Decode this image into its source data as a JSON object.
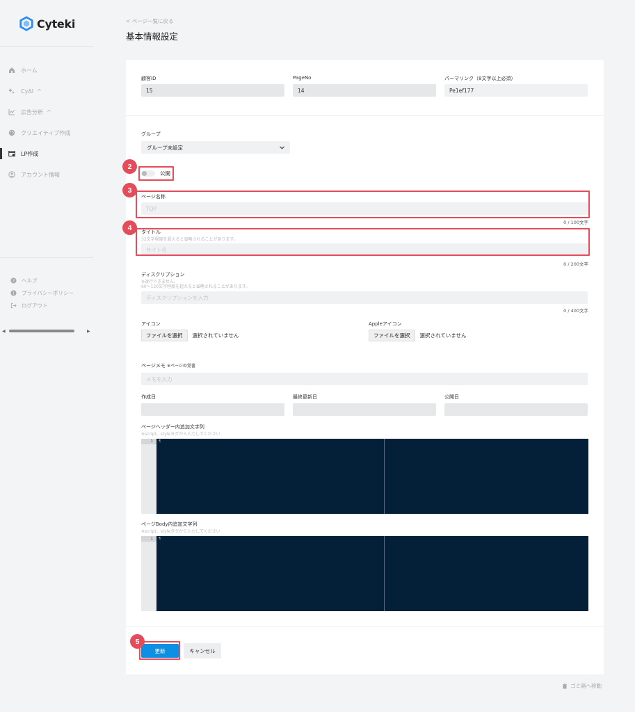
{
  "app": {
    "brand": "Cyteki",
    "brand_color": "#2d8cf0"
  },
  "sidebar": {
    "items": [
      {
        "label": "ホーム",
        "icon": "home-icon"
      },
      {
        "label": "CyAI",
        "icon": "sparkle-icon",
        "chevron": "^"
      },
      {
        "label": "広告分析",
        "icon": "chart-icon",
        "chevron": "^"
      },
      {
        "label": "クリエイティブ作成",
        "icon": "palette-icon"
      },
      {
        "label": "LP作成",
        "icon": "window-icon",
        "active": true
      },
      {
        "label": "アカウント情報",
        "icon": "user-circle-icon"
      }
    ],
    "footer": [
      {
        "label": "ヘルプ",
        "icon": "help-icon"
      },
      {
        "label": "プライバシーポリシー",
        "icon": "info-icon"
      },
      {
        "label": "ログアウト",
        "icon": "logout-icon"
      }
    ],
    "scroll_left": "◀",
    "scroll_right": "▶"
  },
  "header": {
    "back_label": "< ページ一覧に戻る",
    "title": "基本情報設定"
  },
  "form": {
    "customer_id": {
      "label": "顧客ID",
      "value": "15"
    },
    "page_no": {
      "label": "PageNo",
      "value": "14"
    },
    "permalink": {
      "label": "パーマリンク（8文字以上必須）",
      "value": "Pe1ef177"
    },
    "group": {
      "label": "グループ",
      "value": "グループ未設定"
    },
    "publish": {
      "label": "公開"
    },
    "page_name": {
      "label": "ページ名称",
      "placeholder": "TOP",
      "counter": "0 / 100文字"
    },
    "title": {
      "label": "タイトル",
      "hint": "32文字程度を超えると省略されることがあります。",
      "placeholder": "サイト名",
      "counter": "0 / 200文字"
    },
    "description": {
      "label": "ディスクリプション",
      "hint1": "※改行できません。",
      "hint2": "60〜120文字程度を超えると省略されることがあります。",
      "placeholder": "ディスクリプションを入力",
      "counter": "0 / 400文字"
    },
    "icon": {
      "label": "アイコン",
      "button": "ファイルを選択",
      "value": "選択されていません"
    },
    "apple_icon": {
      "label": "Appleアイコン",
      "button": "ファイルを選択",
      "value": "選択されていません"
    },
    "memo": {
      "label": "ページメモ",
      "note": "※ページの覚書",
      "placeholder": "メモを入力"
    },
    "created": {
      "label": "作成日"
    },
    "updated": {
      "label": "最終更新日"
    },
    "published": {
      "label": "公開日"
    },
    "head_code": {
      "label": "ページヘッダー内追加文字列",
      "hint": "※script、styleタグから入力してください",
      "line": "1",
      "cursor": "¶"
    },
    "body_code": {
      "label": "ページBody内追加文字列",
      "hint": "※script、styleタグから入力してください",
      "line": "1",
      "cursor": "¶"
    }
  },
  "actions": {
    "update": "更新",
    "cancel": "キャンセル",
    "trash": "ゴミ箱へ移動"
  },
  "annotations": {
    "badge_2": "2",
    "badge_3": "3",
    "badge_4": "4",
    "badge_5": "5",
    "color": "#e24c5b"
  }
}
